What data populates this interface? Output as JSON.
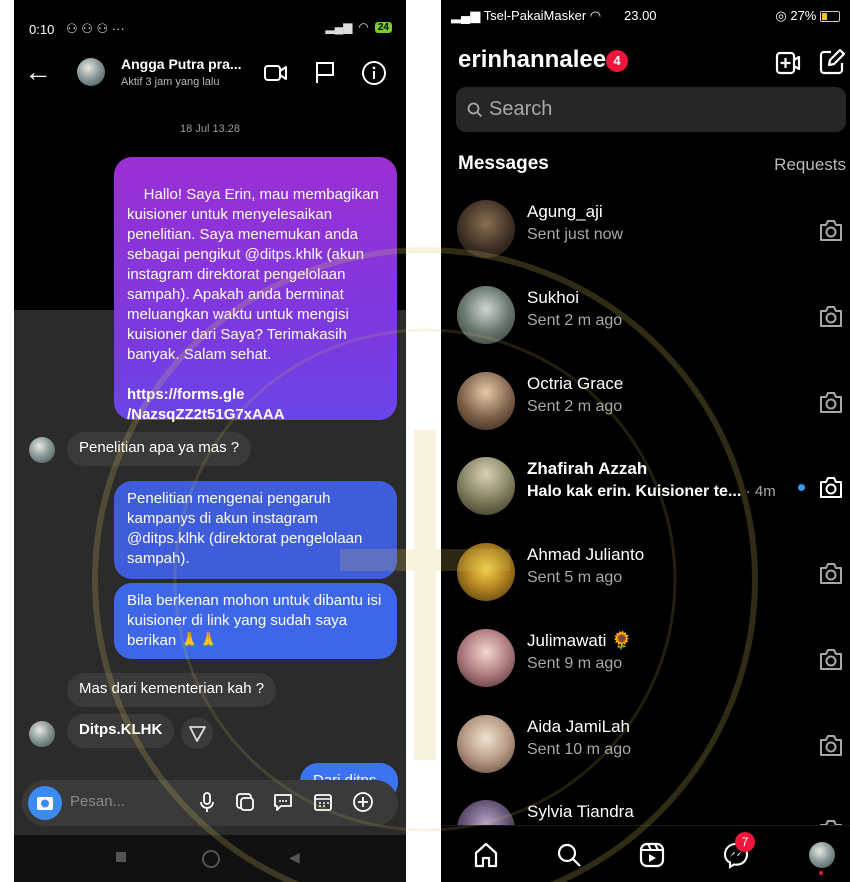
{
  "left": {
    "status": {
      "time": "0:10",
      "battery": "24"
    },
    "header": {
      "name": "Angga Putra pra...",
      "status": "Aktif 3 jam yang lalu"
    },
    "date": "18 Jul 13.28",
    "messages": {
      "m1_text": "Hallo! Saya Erin, mau membagikan kuisioner untuk menyelesaikan penelitian. Saya menemukan anda sebagai pengikut @ditps.khlk (akun instagram direktorat pengelolaan sampah). Apakah anda berminat meluangkan waktu untuk mengisi kuisioner dari Saya? Terimakasih banyak. Salam sehat.",
      "m1_link": "https://forms.gle\n/NazsqZZ2t51G7xAAA",
      "m2": "Penelitian apa ya mas ?",
      "m3": "Penelitian mengenai pengaruh kampanys di akun instagram @ditps.klhk (direktorat pengelolaan sampah).",
      "m4": "Bila berkenan mohon untuk dibantu isi kuisioner di link yang sudah saya berikan 🙏🙏",
      "m5": "Mas dari kementerian kah ?",
      "m6": "Ditps.KLHK",
      "m7": "Dari ditps"
    },
    "composer": {
      "placeholder": "Pesan..."
    }
  },
  "right": {
    "status": {
      "carrier": "Tsel-PakaiMasker",
      "time": "23.00",
      "battery": "27%"
    },
    "username": "erinhannalee",
    "username_badge": "4",
    "search_placeholder": "Search",
    "messages_label": "Messages",
    "requests_label": "Requests",
    "threads": [
      {
        "name": "Agung_aji",
        "status": "Sent just now"
      },
      {
        "name": "Sukhoi",
        "status": "Sent 2 m ago"
      },
      {
        "name": "Octria Grace",
        "status": "Sent 2 m ago"
      },
      {
        "name": "Zhafirah Azzah",
        "status": "Halo kak erin. Kuisioner te...",
        "time": "· 4m",
        "unread": true
      },
      {
        "name": "Ahmad Julianto",
        "status": "Sent 5 m ago"
      },
      {
        "name": "Julimawati 🌻",
        "status": "Sent 9 m ago"
      },
      {
        "name": "Aida JamiLah",
        "status": "Sent 10 m ago"
      },
      {
        "name": "Sylvia Tiandra",
        "status": ""
      }
    ],
    "nav_badge": "7"
  },
  "colors": {
    "accent_blue": "#3897f0",
    "badge_red": "#f0163b",
    "bubble_purple": "#9b2fd4",
    "bubble_blue": "#3f5dda"
  }
}
